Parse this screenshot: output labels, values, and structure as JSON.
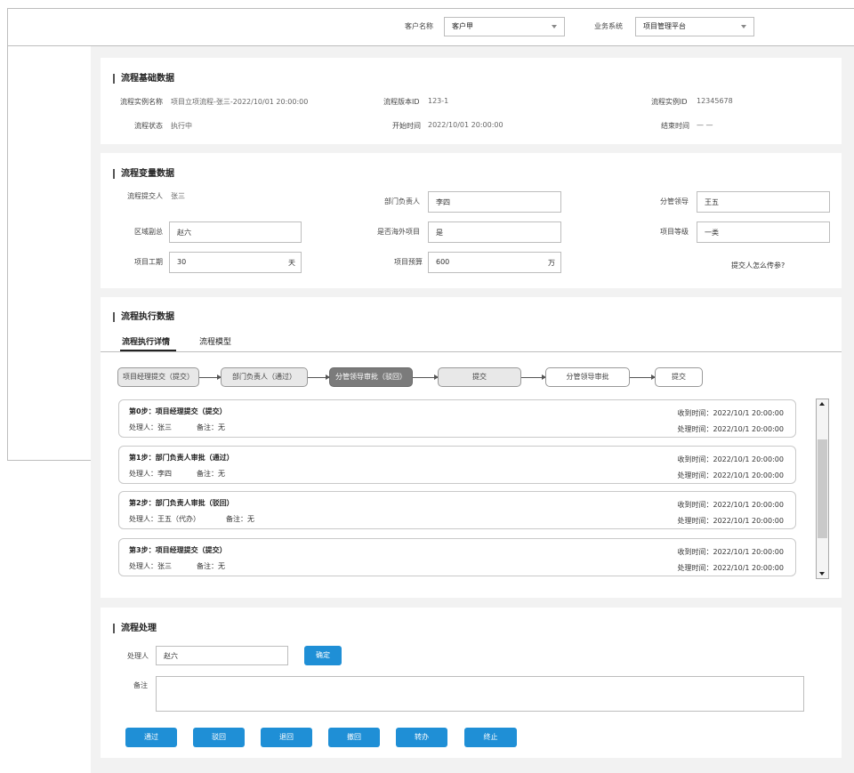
{
  "header": {
    "customer_label": "客户名称",
    "customer_value": "客户甲",
    "system_label": "业务系统",
    "system_value": "项目管理平台"
  },
  "basic": {
    "title": "流程基础数据",
    "instance_name_label": "流程实例名称",
    "instance_name_value": "项目立项流程-张三-2022/10/01  20:00:00",
    "version_label": "流程版本ID",
    "version_value": "123-1",
    "instance_id_label": "流程实例ID",
    "instance_id_value": "12345678",
    "status_label": "流程状态",
    "status_value": "执行中",
    "start_label": "开始时间",
    "start_value": "2022/10/01  20:00:00",
    "end_label": "结束时间",
    "end_value": "— —"
  },
  "vars": {
    "title": "流程变量数据",
    "submitter_label": "流程提交人",
    "submitter_value": "张三",
    "dept_label": "部门负责人",
    "dept_value": "李四",
    "leader_label": "分管领导",
    "leader_value": "王五",
    "region_label": "区域副总",
    "region_value": "赵六",
    "overseas_label": "是否海外项目",
    "overseas_value": "是",
    "level_label": "项目等级",
    "level_value": "一类",
    "period_label": "项目工期",
    "period_value": "30",
    "period_unit": "天",
    "budget_label": "项目预算",
    "budget_value": "600",
    "budget_unit": "万",
    "note": "提交人怎么传参?"
  },
  "exec": {
    "title": "流程执行数据",
    "tabs": [
      "流程执行详情",
      "流程模型"
    ],
    "steps": [
      "项目经理提交（提交）",
      "部门负责人（通过）",
      "分管领导审批（驳回）",
      "提交",
      "分管领导审批",
      "提交"
    ],
    "records": [
      {
        "title": "第0步：项目经理提交（提交）",
        "handler": "处理人：张三",
        "remark": "备注：无",
        "received": "收到时间：2022/10/1  20:00:00",
        "processed": "处理时间：2022/10/1  20:00:00"
      },
      {
        "title": "第1步：部门负责人审批（通过）",
        "handler": "处理人：李四",
        "remark": "备注：无",
        "received": "收到时间：2022/10/1  20:00:00",
        "processed": "处理时间：2022/10/1  20:00:00"
      },
      {
        "title": "第2步：部门负责人审批（驳回）",
        "handler": "处理人：王五（代办）",
        "remark": "备注：无",
        "received": "收到时间：2022/10/1  20:00:00",
        "processed": "处理时间：2022/10/1  20:00:00"
      },
      {
        "title": "第3步：项目经理提交（提交）",
        "handler": "处理人：张三",
        "remark": "备注：无",
        "received": "收到时间：2022/10/1  20:00:00",
        "processed": "处理时间：2022/10/1  20:00:00"
      }
    ]
  },
  "process": {
    "title": "流程处理",
    "handler_label": "处理人",
    "handler_value": "赵六",
    "confirm": "确定",
    "remark_label": "备注",
    "buttons": [
      "通过",
      "驳回",
      "退回",
      "撤回",
      "转办",
      "终止"
    ]
  },
  "colors": {
    "primary": "#1f8fd6",
    "active_step": "#7b7b7b"
  }
}
